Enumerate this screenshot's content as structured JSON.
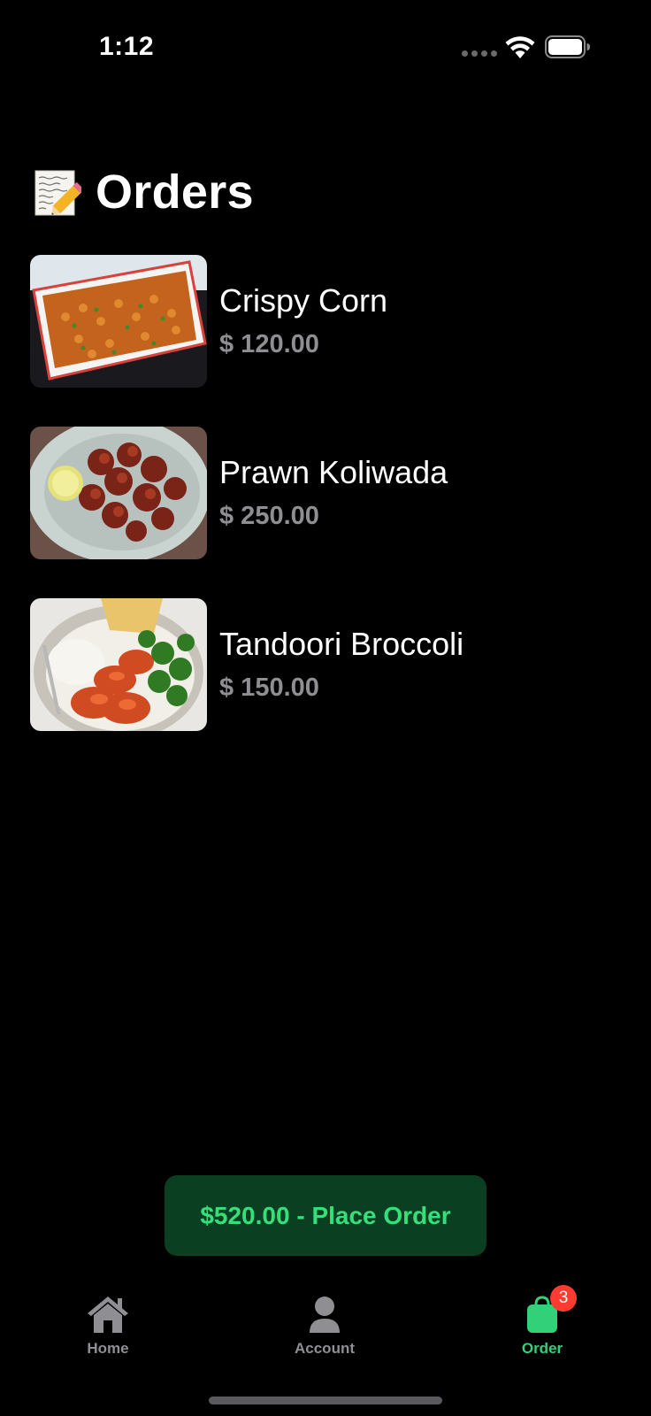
{
  "status_bar": {
    "time": "1:12",
    "icons": [
      "cellular-signal-icon",
      "wifi-icon",
      "battery-icon"
    ]
  },
  "header": {
    "emoji": "memo-icon",
    "title": "Orders"
  },
  "orders": [
    {
      "name": "Crispy Corn",
      "price": "$ 120.00",
      "image": "crispy-corn-image"
    },
    {
      "name": "Prawn Koliwada",
      "price": "$ 250.00",
      "image": "prawn-koliwada-image"
    },
    {
      "name": "Tandoori Broccoli",
      "price": "$ 150.00",
      "image": "tandoori-broccoli-image"
    }
  ],
  "place_order": {
    "label": "$520.00 - Place Order"
  },
  "tab_bar": {
    "tabs": [
      {
        "label": "Home",
        "icon": "home-icon",
        "active": false
      },
      {
        "label": "Account",
        "icon": "person-icon",
        "active": false
      },
      {
        "label": "Order",
        "icon": "bag-icon",
        "active": true,
        "badge": "3"
      }
    ]
  },
  "colors": {
    "background": "#000000",
    "accent": "#33d07a",
    "button_bg": "#0a3f22",
    "price_gray": "#8e8e93",
    "badge_red": "#ff3b30"
  }
}
